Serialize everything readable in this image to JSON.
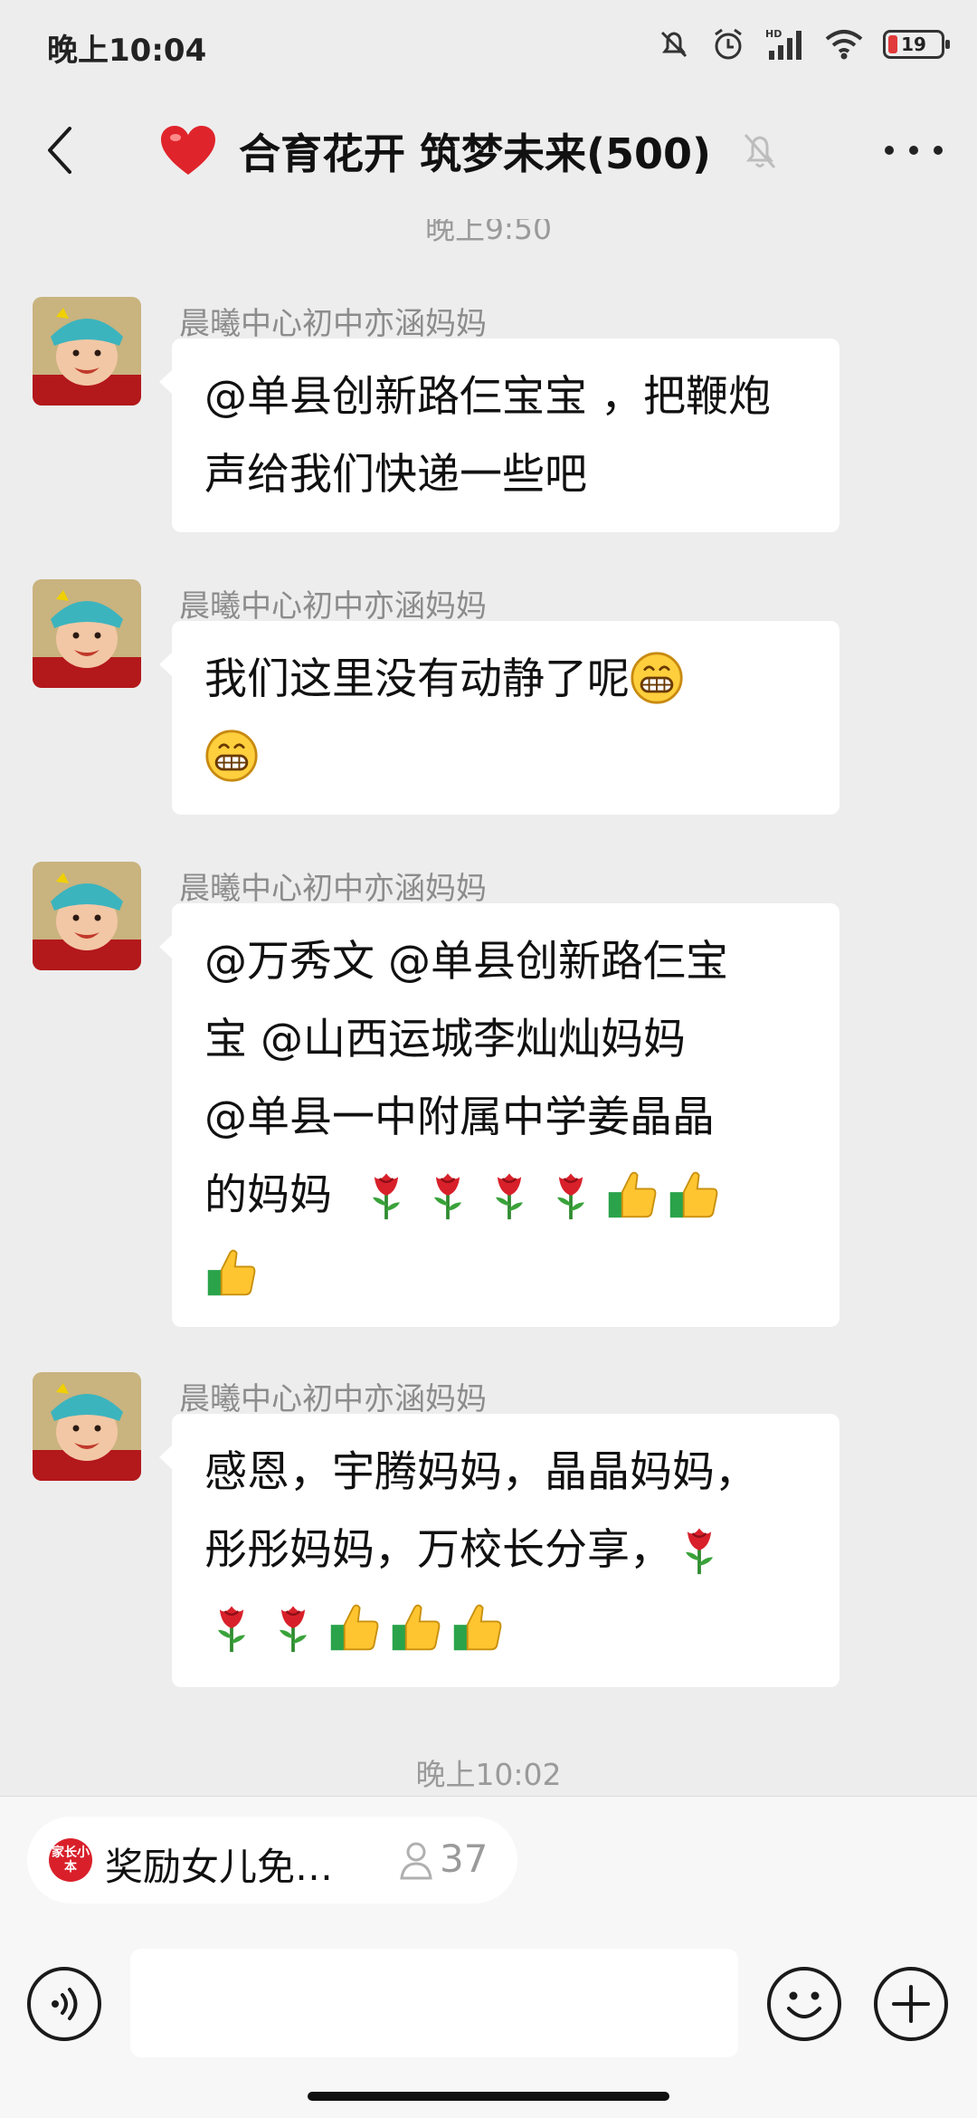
{
  "status_bar": {
    "time": "晚上10:04",
    "battery_level": "19",
    "network_label": "HD"
  },
  "header": {
    "title": "合育花开 筑梦未来(500)",
    "icons": [
      "back-arrow-icon",
      "heart-icon",
      "mute-bell-icon",
      "more-dots-icon"
    ]
  },
  "timestamps": {
    "top": "晚上9:50",
    "bottom": "晚上10:02"
  },
  "messages": [
    {
      "sender": "晨曦中心初中亦涵妈妈",
      "text": "@单县创新路仨宝宝 ，把鞭炮声给我们快递一些吧"
    },
    {
      "sender": "晨曦中心初中亦涵妈妈",
      "text": "我们这里没有动静了呢",
      "emoji": [
        "grin-emoji",
        "grin-emoji"
      ]
    },
    {
      "sender": "晨曦中心初中亦涵妈妈",
      "text_lines": [
        "@万秀文 @单县创新路仨宝",
        "宝 @山西运城李灿灿妈妈",
        "@单县一中附属中学姜晶晶",
        "的妈妈"
      ],
      "emoji": [
        "rose-emoji",
        "rose-emoji",
        "rose-emoji",
        "rose-emoji",
        "thumbs-up-emoji",
        "thumbs-up-emoji",
        "thumbs-up-emoji"
      ]
    },
    {
      "sender": "晨曦中心初中亦涵妈妈",
      "text_lines": [
        "感恩，宇腾妈妈，晶晶妈妈，",
        "彤彤妈妈，万校长分享，"
      ],
      "emoji": [
        "rose-emoji",
        "rose-emoji",
        "rose-emoji",
        "thumbs-up-emoji",
        "thumbs-up-emoji",
        "thumbs-up-emoji"
      ]
    }
  ],
  "mini_app": {
    "name": "奖励女儿免…",
    "count": "37",
    "logo_text": "家长小本"
  },
  "input_bar": {
    "placeholder": "",
    "icons": [
      "voice-icon",
      "emoji-face-icon",
      "plus-icon"
    ]
  },
  "colors": {
    "background": "#ededed",
    "bubble": "#ffffff",
    "sender": "#8c8c8c",
    "timestamp": "#9a9a9a"
  }
}
